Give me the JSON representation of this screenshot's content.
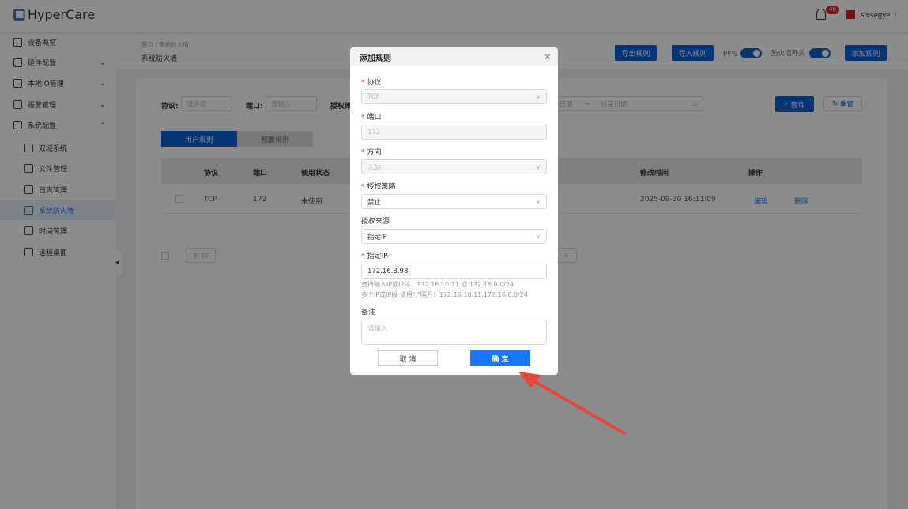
{
  "header": {
    "app_name": "HyperCare",
    "notification_count": "48",
    "username": "sinsegye"
  },
  "sidebar": {
    "items": [
      {
        "label": "设备概览",
        "expandable": false
      },
      {
        "label": "硬件配置",
        "expandable": true
      },
      {
        "label": "本地IO管理",
        "expandable": true
      },
      {
        "label": "报警管理",
        "expandable": true
      },
      {
        "label": "系统配置",
        "expandable": true,
        "expanded": true
      }
    ],
    "sub_items": [
      {
        "label": "双域系统"
      },
      {
        "label": "文件管理"
      },
      {
        "label": "日志管理"
      },
      {
        "label": "系统防火墙",
        "active": true
      },
      {
        "label": "时间管理"
      },
      {
        "label": "远程桌面"
      }
    ]
  },
  "breadcrumb": {
    "home": "首页",
    "sep": "/",
    "current": "系统防火墙"
  },
  "page_title": "系统防火墙",
  "toolbar": {
    "export": "导出规则",
    "import": "导入规则",
    "ping_label": "ping",
    "ping_on": true,
    "firewall_label": "防火墙开关",
    "firewall_on": true,
    "add": "添加规则"
  },
  "filters": {
    "protocol_label": "协议:",
    "protocol_placeholder": "请选择",
    "port_label": "端口:",
    "port_placeholder": "请输入",
    "policy_label": "授权策",
    "start_date": "始日期",
    "date_sep": "→",
    "end_date": "结束日期",
    "search": "查询",
    "reset": "重置"
  },
  "tabs": [
    {
      "label": "用户规则",
      "active": true
    },
    {
      "label": "预置规则"
    }
  ],
  "table": {
    "headers": [
      "协议",
      "端口",
      "使用状态",
      "修改时间",
      "操作"
    ],
    "rows": [
      {
        "protocol": "TCP",
        "port": "172",
        "status": "未使用",
        "modified": "2025-09-30 16:11:09",
        "edit": "编辑",
        "delete": "删除"
      }
    ]
  },
  "footer": {
    "delete": "删 除",
    "page_size": "页"
  },
  "dialog": {
    "title": "添加规则",
    "protocol": {
      "label": "协议",
      "value": "TCP"
    },
    "port": {
      "label": "端口",
      "value": "172"
    },
    "direction": {
      "label": "方向",
      "value": "入站"
    },
    "policy": {
      "label": "授权策略",
      "value": "禁止"
    },
    "source": {
      "label": "授权来源",
      "value": "指定IP"
    },
    "ip": {
      "label": "指定IP",
      "value": "172.16.3.98",
      "hint1": "支持输入IP或IP段：172.16.10.11 或 172.16.0.0/24",
      "hint2": "多个IP或IP段 请用\",\"隔开：172.16.10.11,172.16.0.0/24"
    },
    "remark": {
      "label": "备注",
      "placeholder": "请输入"
    },
    "cancel": "取 消",
    "confirm": "确 定"
  },
  "colors": {
    "primary": "#0063d8",
    "confirm": "#1677ff",
    "arrow": "#e8453c",
    "badge": "#f5222d"
  }
}
